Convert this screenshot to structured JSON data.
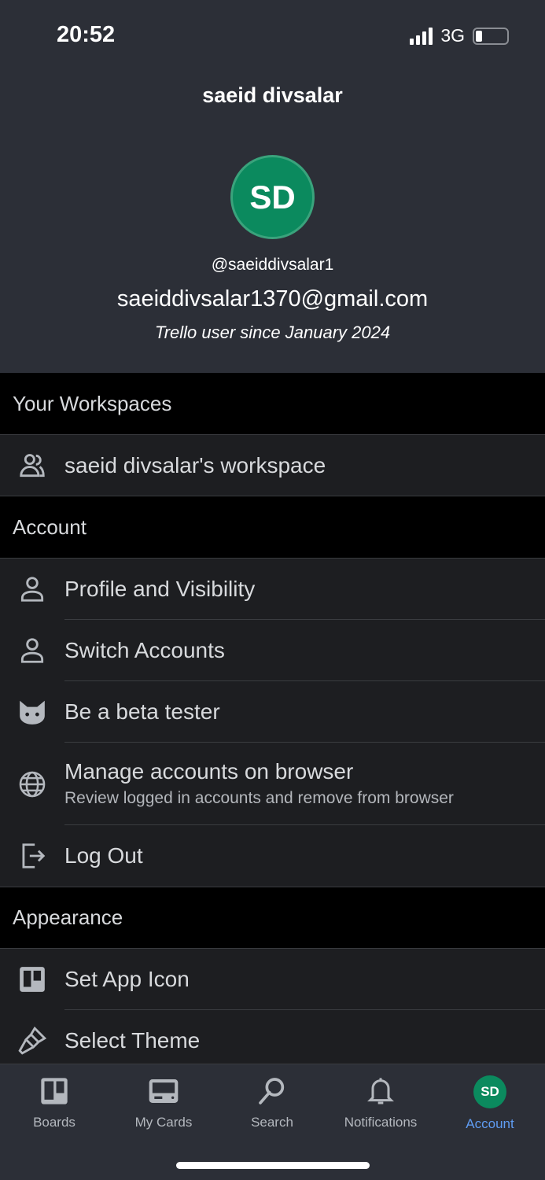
{
  "status_bar": {
    "time": "20:52",
    "network": "3G",
    "battery_percent": 15
  },
  "profile": {
    "name": "saeid divsalar",
    "initials": "SD",
    "handle": "@saeiddivsalar1",
    "email": "saeiddivsalar1370@gmail.com",
    "member_since": "Trello user since January 2024",
    "avatar_color": "#0b8a5e"
  },
  "sections": {
    "workspaces": {
      "title": "Your Workspaces",
      "items": [
        {
          "label": "saeid divsalar's workspace",
          "icon": "workspace-members-icon"
        }
      ]
    },
    "account": {
      "title": "Account",
      "items": [
        {
          "label": "Profile and Visibility",
          "icon": "person-icon"
        },
        {
          "label": "Switch Accounts",
          "icon": "person-icon"
        },
        {
          "label": "Be a beta tester",
          "icon": "taco-icon"
        },
        {
          "label": "Manage accounts on browser",
          "sublabel": "Review logged in accounts and remove from browser",
          "icon": "globe-icon"
        },
        {
          "label": "Log Out",
          "icon": "logout-icon"
        }
      ]
    },
    "appearance": {
      "title": "Appearance",
      "items": [
        {
          "label": "Set App Icon",
          "icon": "board-icon"
        },
        {
          "label": "Select Theme",
          "icon": "paintbrush-icon"
        }
      ]
    }
  },
  "tabbar": {
    "items": [
      {
        "label": "Boards"
      },
      {
        "label": "My Cards"
      },
      {
        "label": "Search"
      },
      {
        "label": "Notifications"
      },
      {
        "label": "Account",
        "initials": "SD",
        "active": true
      }
    ],
    "active_color": "#5f9cf2"
  }
}
